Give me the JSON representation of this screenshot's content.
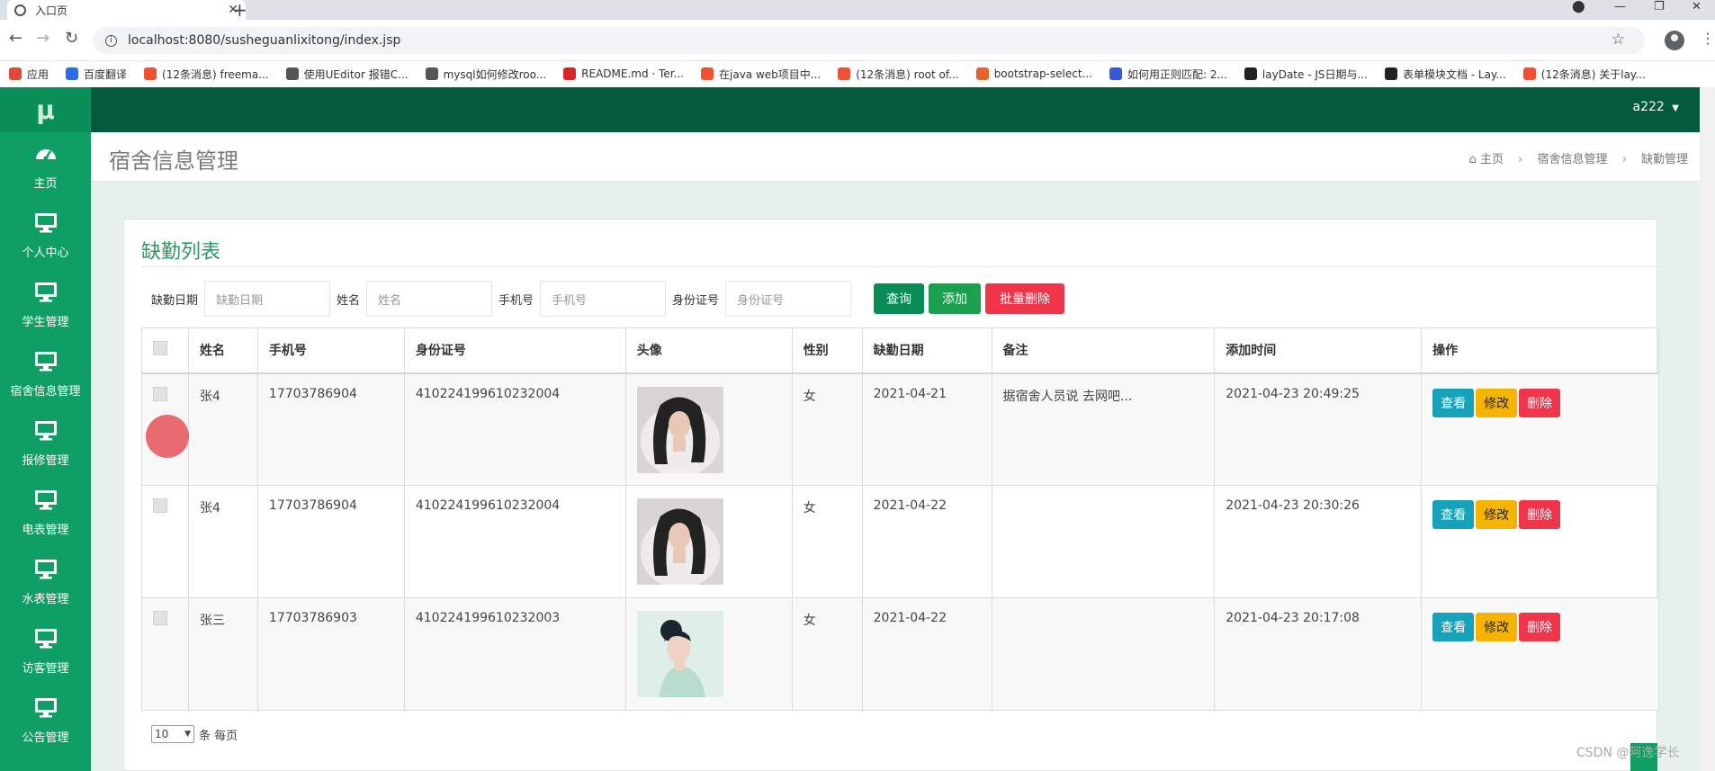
{
  "browser": {
    "tab_title": "入口页",
    "url": "localhost:8080/susheguanlixitong/index.jsp",
    "bookmarks": [
      {
        "label": "应用",
        "color": "#e04a3a"
      },
      {
        "label": "百度翻译",
        "color": "#2b6de8"
      },
      {
        "label": "(12条消息) freema...",
        "color": "#f0502f"
      },
      {
        "label": "使用UEditor 报错C...",
        "color": "#555555"
      },
      {
        "label": "mysql如何修改roo...",
        "color": "#555555"
      },
      {
        "label": "README.md · Ter...",
        "color": "#d7262a"
      },
      {
        "label": "在java web项目中...",
        "color": "#f0502f"
      },
      {
        "label": "(12条消息) root of...",
        "color": "#f0502f"
      },
      {
        "label": "bootstrap-select...",
        "color": "#e8622d"
      },
      {
        "label": "如何用正则匹配: 2...",
        "color": "#3a58d6"
      },
      {
        "label": "layDate - JS日期与...",
        "color": "#222222"
      },
      {
        "label": "表单模块文档 - Lay...",
        "color": "#222222"
      },
      {
        "label": "(12条消息) 关于lay...",
        "color": "#f0502f"
      }
    ]
  },
  "app": {
    "logo": "μ",
    "user": "a222",
    "sidebar": [
      {
        "label": "主页",
        "icon": "dashboard-icon"
      },
      {
        "label": "个人中心",
        "icon": "monitor-icon"
      },
      {
        "label": "学生管理",
        "icon": "monitor-icon"
      },
      {
        "label": "宿舍信息管理",
        "icon": "monitor-icon"
      },
      {
        "label": "报修管理",
        "icon": "monitor-icon"
      },
      {
        "label": "电表管理",
        "icon": "monitor-icon"
      },
      {
        "label": "水表管理",
        "icon": "monitor-icon"
      },
      {
        "label": "访客管理",
        "icon": "monitor-icon"
      },
      {
        "label": "公告管理",
        "icon": "monitor-icon"
      }
    ],
    "page_title": "宿舍信息管理",
    "breadcrumb": [
      "主页",
      "宿舍信息管理",
      "缺勤管理"
    ]
  },
  "card": {
    "title": "缺勤列表",
    "search": {
      "date_label": "缺勤日期",
      "date_placeholder": "缺勤日期",
      "name_label": "姓名",
      "name_placeholder": "姓名",
      "phone_label": "手机号",
      "phone_placeholder": "手机号",
      "id_label": "身份证号",
      "id_placeholder": "身份证号"
    },
    "buttons": {
      "query": "查询",
      "add": "添加",
      "batch_delete": "批量删除"
    },
    "columns": [
      "姓名",
      "手机号",
      "身份证号",
      "头像",
      "性别",
      "缺勤日期",
      "备注",
      "添加时间",
      "操作"
    ],
    "rows": [
      {
        "name": "张4",
        "phone": "17703786904",
        "id": "410224199610232004",
        "gender": "女",
        "date": "2021-04-21",
        "note": "据宿舍人员说 去网吧...",
        "added": "2021-04-23 20:49:25"
      },
      {
        "name": "张4",
        "phone": "17703786904",
        "id": "410224199610232004",
        "gender": "女",
        "date": "2021-04-22",
        "note": "",
        "added": "2021-04-23 20:30:26"
      },
      {
        "name": "张三",
        "phone": "17703786903",
        "id": "410224199610232003",
        "gender": "女",
        "date": "2021-04-22",
        "note": "",
        "added": "2021-04-23 20:17:08"
      }
    ],
    "row_actions": {
      "view": "查看",
      "edit": "修改",
      "delete": "删除"
    },
    "pager": {
      "page_size": "10",
      "suffix": "条 每页"
    }
  },
  "watermark": "CSDN @阿逸学长"
}
